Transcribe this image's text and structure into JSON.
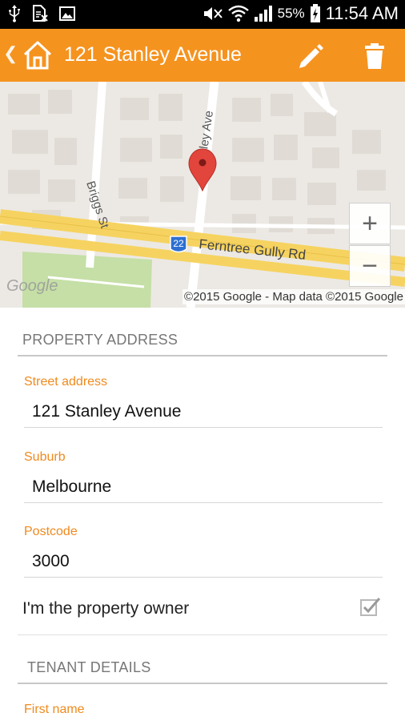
{
  "status_bar": {
    "battery": "55%",
    "time": "11:54 AM"
  },
  "app_bar": {
    "title": "121 Stanley Avenue",
    "icons": [
      "back-chevron-icon",
      "home-icon",
      "edit-icon",
      "delete-icon"
    ]
  },
  "map": {
    "streets": [
      "Briggs St",
      "Stanley Ave",
      "Ferntree Gully Rd"
    ],
    "route_badge": "22",
    "zoom_in_label": "+",
    "zoom_out_label": "−",
    "attribution": "©2015 Google - Map data ©2015 Google",
    "logo": "Google"
  },
  "property": {
    "header": "PROPERTY ADDRESS",
    "street_label": "Street address",
    "street_value": "121 Stanley Avenue",
    "suburb_label": "Suburb",
    "suburb_value": "Melbourne",
    "postcode_label": "Postcode",
    "postcode_value": "3000",
    "owner_label": "I'm the property owner",
    "owner_checked": true
  },
  "tenant": {
    "header": "TENANT DETAILS",
    "first_name_label": "First name"
  },
  "colors": {
    "accent": "#f5931f",
    "label_orange": "#ef8a1e",
    "road_yellow": "#f6d360",
    "map_bg": "#ece9e4"
  }
}
